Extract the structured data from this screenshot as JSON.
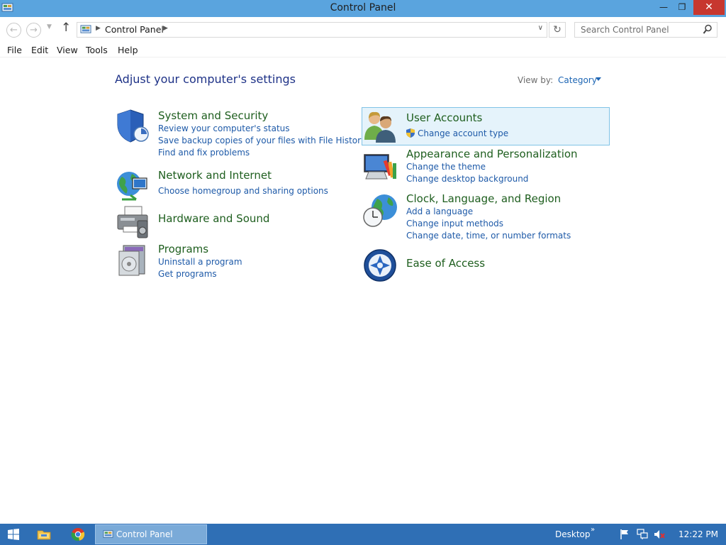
{
  "window": {
    "title": "Control Panel"
  },
  "address": {
    "path": "Control Panel",
    "search_placeholder": "Search Control Panel"
  },
  "menu": [
    "File",
    "Edit",
    "View",
    "Tools",
    "Help"
  ],
  "content": {
    "heading": "Adjust your computer's settings",
    "view_by_label": "View by:",
    "view_by_value": "Category"
  },
  "categories": {
    "system_security": {
      "title": "System and Security",
      "links": [
        "Review your computer's status",
        "Save backup copies of your files with File History",
        "Find and fix problems"
      ]
    },
    "network": {
      "title": "Network and Internet",
      "links": [
        "Choose homegroup and sharing options"
      ]
    },
    "hardware": {
      "title": "Hardware and Sound"
    },
    "programs": {
      "title": "Programs",
      "links": [
        "Uninstall a program",
        "Get programs"
      ]
    },
    "user_accounts": {
      "title": "User Accounts",
      "links": [
        "Change account type"
      ]
    },
    "appearance": {
      "title": "Appearance and Personalization",
      "links": [
        "Change the theme",
        "Change desktop background"
      ]
    },
    "clock": {
      "title": "Clock, Language, and Region",
      "links": [
        "Add a language",
        "Change input methods",
        "Change date, time, or number formats"
      ]
    },
    "ease": {
      "title": "Ease of Access"
    }
  },
  "taskbar": {
    "active_window": "Control Panel",
    "desktop_label": "Desktop",
    "chevron": "»",
    "time": "12:22 PM"
  },
  "colors": {
    "titlebar": "#5aa4de",
    "heading": "#1e3287",
    "category_title": "#1e5e1e",
    "link": "#1e5aa8",
    "taskbar": "#2f6fb5",
    "highlight": "#e5f3fb",
    "close_button": "#c7372f"
  },
  "icons": [
    "control-panel-icon",
    "back-arrow-icon",
    "forward-arrow-icon",
    "up-arrow-icon",
    "refresh-icon",
    "search-icon",
    "shield-icon",
    "globe-network-icon",
    "printer-icon",
    "programs-icon",
    "users-icon",
    "display-paint-icon",
    "clock-globe-icon",
    "ease-of-access-icon",
    "windows-start-icon",
    "file-explorer-icon",
    "chrome-icon",
    "flag-icon",
    "network-icon",
    "speaker-muted-icon"
  ]
}
